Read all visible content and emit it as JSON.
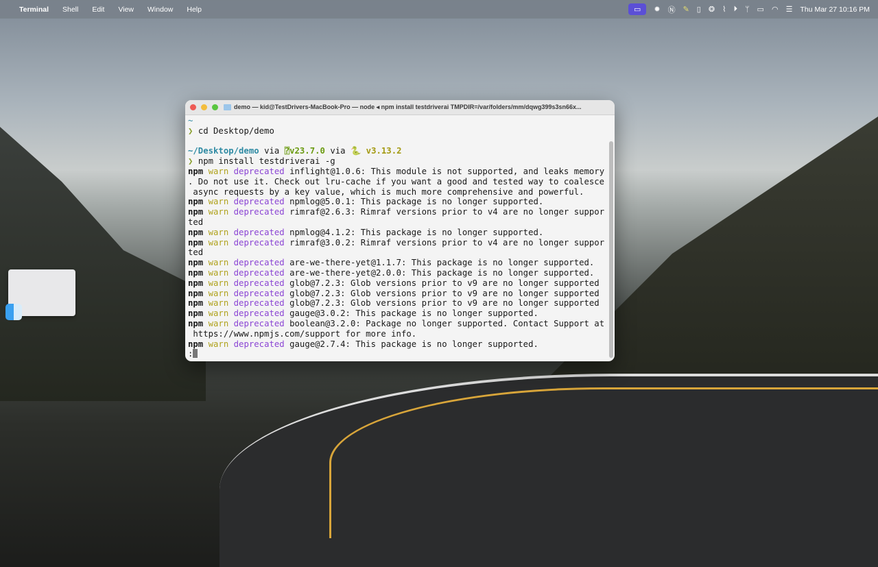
{
  "menubar": {
    "app": "Terminal",
    "items": [
      "Shell",
      "Edit",
      "View",
      "Window",
      "Help"
    ],
    "clock": "Thu Mar 27  10:16 PM",
    "status_icons": [
      "screen-share-icon",
      "gear-icon",
      "notion-icon",
      "pencil-icon",
      "clipboard-icon",
      "openai-icon",
      "paperclip-icon",
      "play-icon",
      "airpods-icon",
      "battery-icon",
      "wifi-icon",
      "control-center-icon"
    ]
  },
  "terminal": {
    "title": "demo — kid@TestDrivers-MacBook-Pro — node ◂ npm install testdriverai TMPDIR=/var/folders/mm/dqwg399s3sn66x...",
    "tilde": "~",
    "cmd1": "cd Desktop/demo",
    "prompt_path": "~/Desktop/demo",
    "via": "via",
    "node_ver": "v23.7.0",
    "py_ver": "v3.13.2",
    "cmd2": "npm install testdriverai -g",
    "warnings": [
      {
        "msg": "inflight@1.0.6: This module is not supported, and leaks memory",
        "cont": [
          ". Do not use it. Check out lru-cache if you want a good and tested way to coalesce",
          " async requests by a key value, which is much more comprehensive and powerful."
        ]
      },
      {
        "msg": "npmlog@5.0.1: This package is no longer supported."
      },
      {
        "msg": "rimraf@2.6.3: Rimraf versions prior to v4 are no longer suppor",
        "cont": [
          "ted"
        ]
      },
      {
        "msg": "npmlog@4.1.2: This package is no longer supported."
      },
      {
        "msg": "rimraf@3.0.2: Rimraf versions prior to v4 are no longer suppor",
        "cont": [
          "ted"
        ]
      },
      {
        "msg": "are-we-there-yet@1.1.7: This package is no longer supported."
      },
      {
        "msg": "are-we-there-yet@2.0.0: This package is no longer supported."
      },
      {
        "msg": "glob@7.2.3: Glob versions prior to v9 are no longer supported"
      },
      {
        "msg": "glob@7.2.3: Glob versions prior to v9 are no longer supported"
      },
      {
        "msg": "glob@7.2.3: Glob versions prior to v9 are no longer supported"
      },
      {
        "msg": "gauge@3.0.2: This package is no longer supported."
      },
      {
        "msg": "boolean@3.2.0: Package no longer supported. Contact Support at",
        "cont": [
          " https://www.npmjs.com/support for more info."
        ]
      },
      {
        "msg": "gauge@2.7.4: This package is no longer supported."
      }
    ],
    "npm": "npm",
    "warn": "warn",
    "deprecated": "deprecated",
    "last": ":"
  }
}
